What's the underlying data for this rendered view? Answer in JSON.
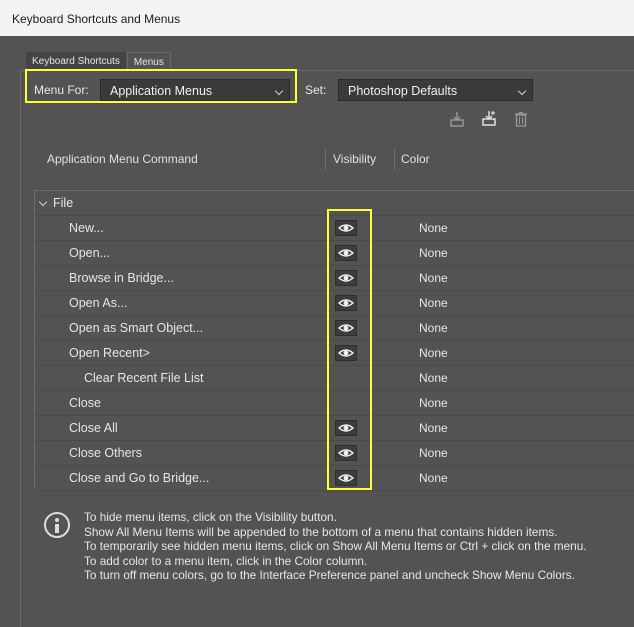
{
  "window": {
    "title": "Keyboard Shortcuts and Menus"
  },
  "tabs": [
    {
      "label": "Keyboard Shortcuts",
      "active": false
    },
    {
      "label": "Menus",
      "active": true
    }
  ],
  "menu_for": {
    "label": "Menu For:",
    "value": "Application Menus"
  },
  "set": {
    "label": "Set:",
    "value": "Photoshop Defaults"
  },
  "toolbar": {
    "icons": [
      "save-set-icon",
      "save-set-as-icon",
      "delete-set-icon"
    ]
  },
  "columns": {
    "command": "Application Menu Command",
    "visibility": "Visibility",
    "color": "Color"
  },
  "group": {
    "label": "File",
    "expanded": true
  },
  "rows": [
    {
      "name": "New...",
      "visible": true,
      "color": "None",
      "indent": 1
    },
    {
      "name": "Open...",
      "visible": true,
      "color": "None",
      "indent": 1
    },
    {
      "name": "Browse in Bridge...",
      "visible": true,
      "color": "None",
      "indent": 1
    },
    {
      "name": "Open As...",
      "visible": true,
      "color": "None",
      "indent": 1
    },
    {
      "name": "Open as Smart Object...",
      "visible": true,
      "color": "None",
      "indent": 1
    },
    {
      "name": "Open Recent>",
      "visible": true,
      "color": "None",
      "indent": 1
    },
    {
      "name": "Clear Recent File List",
      "visible": false,
      "color": "None",
      "indent": 2
    },
    {
      "name": "Close",
      "visible": false,
      "color": "None",
      "indent": 1
    },
    {
      "name": "Close All",
      "visible": true,
      "color": "None",
      "indent": 1
    },
    {
      "name": "Close Others",
      "visible": true,
      "color": "None",
      "indent": 1
    },
    {
      "name": "Close and Go to Bridge...",
      "visible": true,
      "color": "None",
      "indent": 1
    }
  ],
  "info_lines": [
    "To hide menu items, click on the Visibility button.",
    "Show All Menu Items will be appended to the bottom of a menu that contains hidden items.",
    "To temporarily see hidden menu items, click on Show All Menu Items or Ctrl + click on the menu.",
    "To add color to a menu item, click in the Color column.",
    "To turn off menu colors, go to the Interface Preference panel and uncheck Show Menu Colors."
  ],
  "colors": {
    "highlight": "#ffff33",
    "dialog_bg": "#535353",
    "field_bg": "#3a3a3a"
  }
}
